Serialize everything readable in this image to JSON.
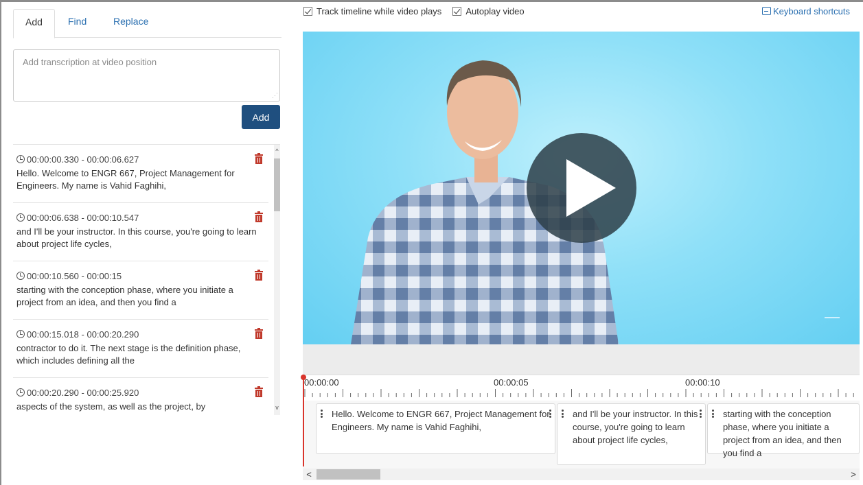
{
  "tabs": [
    {
      "label": "Add",
      "active": true
    },
    {
      "label": "Find",
      "active": false
    },
    {
      "label": "Replace",
      "active": false
    }
  ],
  "add_panel": {
    "placeholder": "Add transcription at video position",
    "value": "",
    "add_button_label": "Add"
  },
  "cues": [
    {
      "time": "00:00:00.330 - 00:00:06.627",
      "text": "Hello. Welcome to ENGR 667, Project Management for Engineers. My name is Vahid Faghihi,"
    },
    {
      "time": "00:00:06.638 - 00:00:10.547",
      "text": "and I'll be your instructor. In this course, you're going to learn about project life cycles,"
    },
    {
      "time": "00:00:10.560 - 00:00:15",
      "text": "starting with the conception phase, where you initiate a project from an idea, and then you find a"
    },
    {
      "time": "00:00:15.018 - 00:00:20.290",
      "text": "contractor to do it. The next stage is the definition phase, which includes defining all the"
    },
    {
      "time": "00:00:20.290 - 00:00:25.920",
      "text": "aspects of the system, as well as the project, by"
    }
  ],
  "options": {
    "track_timeline_label": "Track timeline while video plays",
    "track_timeline_checked": true,
    "autoplay_label": "Autoplay video",
    "autoplay_checked": true,
    "keyboard_shortcuts_label": "Keyboard shortcuts"
  },
  "timeline": {
    "labels": [
      "00:00:00",
      "00:00:05",
      "00:00:10"
    ],
    "cards": [
      "Hello. Welcome to ENGR 667, Project Management for Engineers. My name is Vahid Faghihi,",
      "and I'll be your instructor. In this course, you're going to learn about project life cycles,",
      "starting with the conception phase, where you initiate a project from an idea, and then you find a"
    ]
  },
  "colors": {
    "accent": "#1f4f7f",
    "link": "#2a6fb0",
    "delete": "#c0392b",
    "playhead": "#d9342b",
    "video_background": "#7fd8f6"
  },
  "icons": [
    "clock-icon",
    "trash-icon",
    "checkbox-icon",
    "keyboard-icon",
    "play-icon",
    "drag-handle-icon"
  ]
}
